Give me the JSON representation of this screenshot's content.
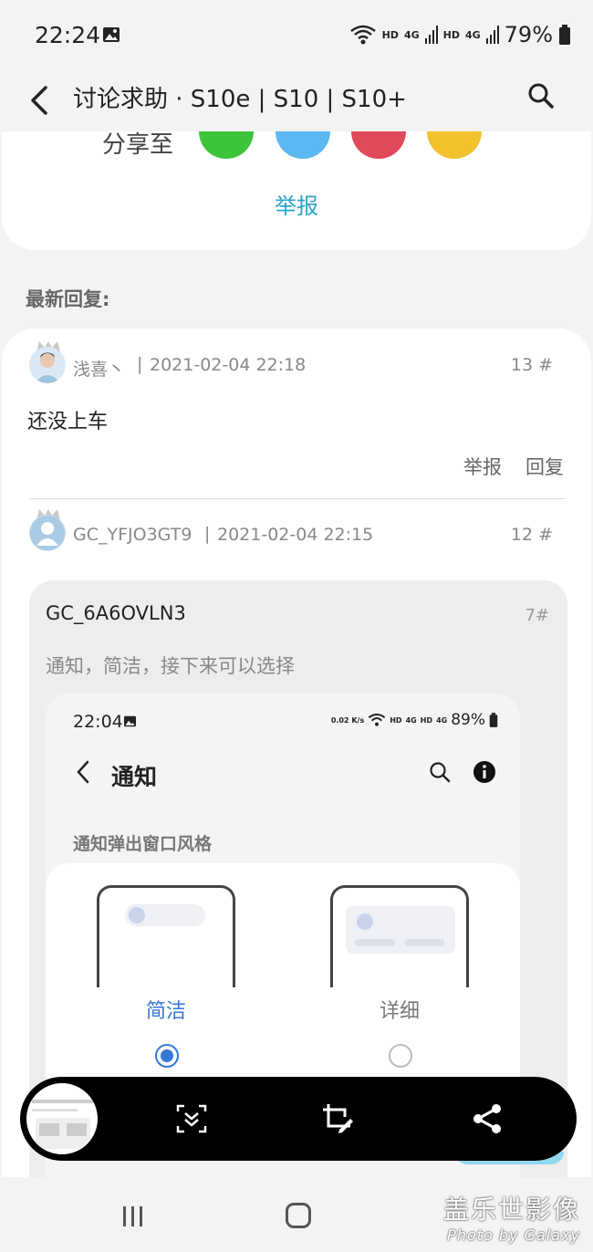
{
  "status_bar": {
    "time": "22:24",
    "hd1": "HD",
    "hd2": "HD",
    "net1": "4G",
    "net2": "4G",
    "battery": "79%"
  },
  "header": {
    "title": "讨论求助 · S10e | S10 | S10+"
  },
  "share": {
    "label": "分享至",
    "report": "举报",
    "colors": [
      "#3cc43c",
      "#5bb8f0",
      "#e14a5a",
      "#f2c12e"
    ]
  },
  "replies_section": {
    "title": "最新回复:"
  },
  "replies": [
    {
      "author": "浅喜丶",
      "separator": "|",
      "date": "2021-02-04 22:18",
      "floor": "13 #",
      "content": "还没上车",
      "report": "举报",
      "reply": "回复"
    },
    {
      "author": "GC_YFJO3GT9",
      "separator": "|",
      "date": "2021-02-04 22:15",
      "floor": "12 #"
    }
  ],
  "quote": {
    "user": "GC_6A6OVLN3",
    "floor": "7#",
    "text": "通知，简洁，接下来可以选择",
    "screenshot": {
      "time": "22:04",
      "speed": "0.02 K/s",
      "hd1": "HD",
      "hd2": "HD",
      "net1": "4G",
      "net2": "4G",
      "battery": "89%",
      "title": "通知",
      "section": "通知弹出窗口风格",
      "options": [
        {
          "label": "简洁",
          "selected": true
        },
        {
          "label": "详细",
          "selected": false
        }
      ],
      "accent": "#3478d4"
    }
  },
  "watermark": {
    "cn": "盖乐世影像",
    "en": "Photo by Galaxy"
  }
}
